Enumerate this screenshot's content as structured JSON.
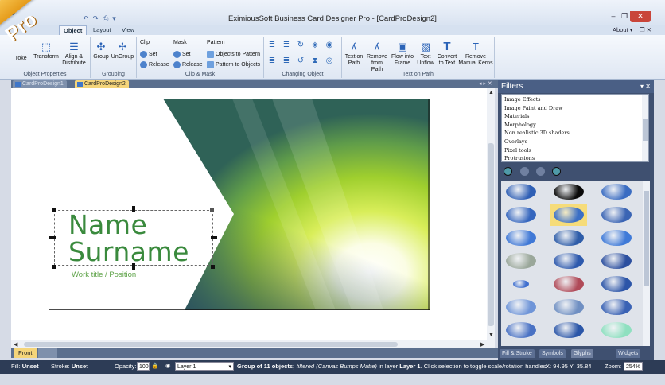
{
  "window": {
    "title": "EximiousSoft Business Card Designer Pro - [CardProDesign2]",
    "min": "–",
    "max": "❐",
    "close": "✕"
  },
  "logo": {
    "text": "Pro"
  },
  "menu_tabs": {
    "object": "Object",
    "layout": "Layout",
    "view": "View",
    "about": "About"
  },
  "ribbon": {
    "object_properties": {
      "stroke": "roke",
      "transform": "Transform",
      "align": "Align &",
      "distribute": "Distribute",
      "label": "Object Properties"
    },
    "grouping": {
      "group": "Group",
      "ungroup": "UnGroup",
      "label": "Grouping"
    },
    "clip_mask": {
      "clip": "Clip",
      "clip_set": "Set",
      "clip_release": "Release",
      "mask": "Mask",
      "mask_set": "Set",
      "mask_release": "Release",
      "pattern": "Pattern",
      "objects_to_pattern": "Objects to Pattern",
      "pattern_to_objects": "Pattern to Objects",
      "label": "Clip & Mask"
    },
    "changing_object": {
      "label": "Changing Object"
    },
    "text_on_path": {
      "items": [
        {
          "l1": "Text on",
          "l2": "Path",
          "icon": "ʎ"
        },
        {
          "l1": "Remove",
          "l2": "from Path",
          "icon": "ʎ"
        },
        {
          "l1": "Flow into",
          "l2": "Frame",
          "icon": "▣"
        },
        {
          "l1": "Text",
          "l2": "Unflow",
          "icon": "▧"
        },
        {
          "l1": "Convert",
          "l2": "to Text",
          "icon": "T"
        },
        {
          "l1": "Remove",
          "l2": "Manual Kerns",
          "icon": "T"
        }
      ],
      "label": "Text on Path"
    }
  },
  "doc_tabs": {
    "tab1": "CardProDesign1",
    "tab2": "CardProDesign2"
  },
  "card": {
    "name": "Name",
    "surname": "Surname",
    "position": "Work title / Position",
    "colors": {
      "text_green": "#3a8a3d",
      "accent_lime": "#b9de2a",
      "dark_teal": "#2e5d6e"
    }
  },
  "page_tabs": {
    "front": "Front"
  },
  "filters": {
    "title": "Filters",
    "items": [
      "Image Effects",
      "Image Paint and Draw",
      "Materials",
      "Morphology",
      "Non realistic 3D shaders",
      "Overlays",
      "Pixel tools",
      "Protrusions"
    ],
    "panel_tabs": [
      "Fill & Stroke",
      "Symbols",
      "Glyphs",
      "Widgets"
    ]
  },
  "status": {
    "fill_label": "Fill:",
    "fill_value": "Unset",
    "stroke_label": "Stroke:",
    "stroke_value": "Unset",
    "opacity_label": "Opacity:",
    "opacity_value": "100",
    "layer_value": "Layer 1",
    "message_prefix": "Group of 11 objects; ",
    "message_italic": "filtered (Canvas Bumps Matte)",
    "message_mid": " in layer ",
    "message_layer": "Layer 1",
    "message_suffix": ". Click selection to toggle scale/rotation handles.",
    "x_label": "X:",
    "x_value": "94.95",
    "y_label": "Y:",
    "y_value": "35.84",
    "zoom_label": "Zoom:",
    "zoom_value": "254%"
  }
}
